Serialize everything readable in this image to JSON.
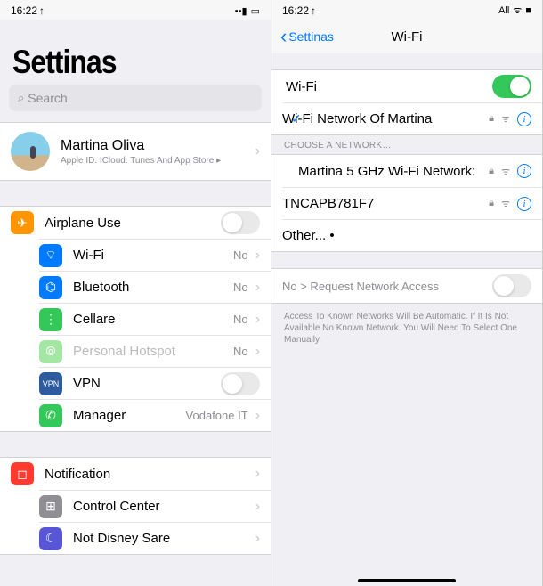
{
  "status": {
    "time": "16:22",
    "loc": "↑",
    "all": "All",
    "signal": "▮▮",
    "wifi": "≙",
    "batt": "■"
  },
  "left": {
    "title": "Settinas",
    "search_ph": "Search",
    "profile": {
      "name": "Martina Oliva",
      "sub": "Apple ID. ICloud. Tunes And App Store ▸"
    },
    "rows": {
      "airplane": "Airplane Use",
      "wifi": "Wi-Fi",
      "wifi_val": "No",
      "bt": "Bluetooth",
      "bt_val": "No",
      "cell": "Cellare",
      "cell_val": "No",
      "hotspot": "Personal Hotspot",
      "hotspot_val": "No",
      "vpn": "VPN",
      "carrier": "Manager",
      "carrier_val": "Vodafone IT",
      "notif": "Notification",
      "cc": "Control Center",
      "dnd": "Not Disney Sare"
    }
  },
  "right": {
    "back": "Settinas",
    "title": "Wi-Fi",
    "wifi_label": "Wi-Fi",
    "connected": "Wi-Fi Network Of Martina",
    "choose": "CHOOSE A NETWORK…",
    "nets": [
      "Martina 5 GHz Wi-Fi Network:",
      "TNCAPB781F7",
      "Other... •"
    ],
    "req": "No >  Request Network Access",
    "footer": "Access To Known Networks Will Be Automatic. If It Is Not Available No Known Network. You Will Need To Select One Manually."
  }
}
